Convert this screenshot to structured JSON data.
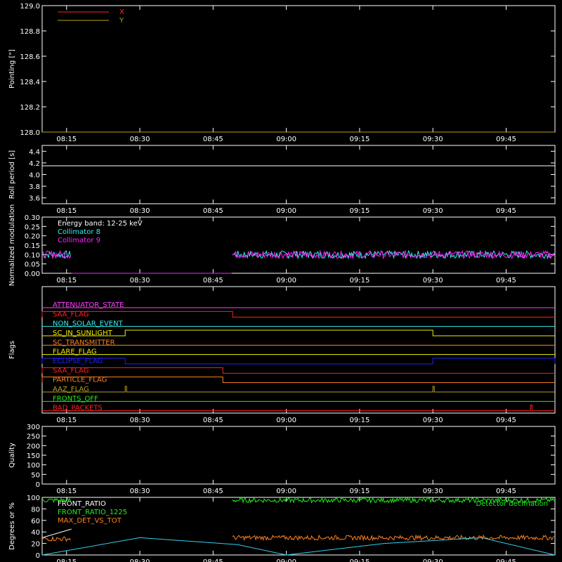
{
  "time_ticks": [
    "08:15",
    "08:30",
    "08:45",
    "09:00",
    "09:15",
    "09:30",
    "09:45"
  ],
  "chart_data": [
    {
      "type": "line",
      "ylabel": "Pointing [\"]",
      "ylim": [
        128.0,
        129.0
      ],
      "yticks": [
        "128.0",
        "128.2",
        "128.4",
        "128.6",
        "128.8",
        "129.0"
      ],
      "series": [
        {
          "name": "X",
          "color": "#ff2020",
          "x": [
            "08:10",
            "09:55"
          ],
          "values": [
            128.0,
            128.0
          ]
        },
        {
          "name": "Y",
          "color": "#b8a020",
          "x": [
            "08:10",
            "09:55"
          ],
          "values": [
            128.0,
            128.0
          ]
        }
      ],
      "legend": "top-left"
    },
    {
      "type": "line",
      "ylabel": "Roll period [s]",
      "ylim": [
        3.5,
        4.5
      ],
      "yticks": [
        "3.6",
        "3.8",
        "4.0",
        "4.2",
        "4.4"
      ],
      "series": [
        {
          "color": "#ffffff",
          "x": [
            "08:10",
            "09:55"
          ],
          "values": [
            4.15,
            4.15
          ]
        }
      ]
    },
    {
      "type": "line",
      "ylabel": "Normalized modulation",
      "ylim": [
        0.0,
        0.3
      ],
      "yticks": [
        "0.00",
        "0.05",
        "0.10",
        "0.15",
        "0.20",
        "0.25",
        "0.30"
      ],
      "annotation": "Energy band: 12-25 keV",
      "series": [
        {
          "name": "Collimator 8",
          "color": "#30f0f0",
          "segments": [
            {
              "x": [
                "08:10",
                "08:16"
              ],
              "level": 0.1
            },
            {
              "x": [
                "08:16",
                "08:49"
              ],
              "level": 0.0
            },
            {
              "x": [
                "08:49",
                "09:55"
              ],
              "level": 0.1
            }
          ]
        },
        {
          "name": "Collimator 9",
          "color": "#ff20ff",
          "segments": [
            {
              "x": [
                "08:10",
                "08:16"
              ],
              "level": 0.1
            },
            {
              "x": [
                "08:16",
                "08:49"
              ],
              "level": 0.0
            },
            {
              "x": [
                "08:49",
                "09:55"
              ],
              "level": 0.1
            }
          ]
        }
      ],
      "legend": "top-left"
    },
    {
      "type": "line",
      "ylabel": "Flags",
      "flags": [
        {
          "name": "ATTENUATOR_STATE",
          "color": "#ff40ff",
          "events": []
        },
        {
          "name": "SAA_FLAG",
          "color": "#ff2020",
          "events": [
            [
              "08:10",
              "08:49"
            ]
          ]
        },
        {
          "name": "NON_SOLAR_EVENT",
          "color": "#30f0f0",
          "events": []
        },
        {
          "name": "SC_IN_SUNLIGHT",
          "color": "#f0f000",
          "events": [
            [
              "08:27",
              "09:30"
            ]
          ]
        },
        {
          "name": "SC_TRANSMITTER",
          "color": "#ff8020",
          "events": []
        },
        {
          "name": "FLARE_FLAG",
          "color": "#f0f000",
          "events": []
        },
        {
          "name": "ECLIPSE_FLAG",
          "color": "#2020ff",
          "events": [
            [
              "08:10",
              "08:27"
            ],
            [
              "09:30",
              "09:55"
            ]
          ]
        },
        {
          "name": "SAA_FLAG",
          "color": "#ff2020",
          "events": [
            [
              "08:10",
              "08:47"
            ]
          ]
        },
        {
          "name": "PARTICLE_FLAG",
          "color": "#ff8020",
          "events": [
            [
              "08:10",
              "08:47"
            ]
          ]
        },
        {
          "name": "AAZ_FLAG",
          "color": "#b8a020",
          "events": [
            [
              "08:27",
              "08:27"
            ],
            [
              "09:30",
              "09:30"
            ]
          ]
        },
        {
          "name": "FRONTS_OFF",
          "color": "#20f020",
          "events": []
        },
        {
          "name": "BAD_PACKETS",
          "color": "#ff2020",
          "events": [
            [
              "09:50",
              "09:50"
            ]
          ]
        }
      ]
    },
    {
      "type": "line",
      "ylabel": "Quality",
      "ylim": [
        0,
        300
      ],
      "yticks": [
        "0",
        "50",
        "100",
        "150",
        "200",
        "250",
        "300"
      ],
      "series": []
    },
    {
      "type": "line",
      "ylabel": "Degrees or %",
      "ylim": [
        0,
        100
      ],
      "yticks": [
        "0",
        "20",
        "40",
        "60",
        "80",
        "100"
      ],
      "annotation": "Detector decimation",
      "series": [
        {
          "name": "FRONT_RATIO",
          "color": "#ffffff",
          "x": [
            "08:10",
            "08:16"
          ],
          "values": [
            30,
            45
          ]
        },
        {
          "name": "FRONT_RATIO_1225",
          "color": "#20f020",
          "segments": [
            {
              "x": [
                "08:10",
                "08:16"
              ],
              "level": 95
            },
            {
              "x": [
                "08:49",
                "09:55"
              ],
              "level": 95
            }
          ]
        },
        {
          "name": "MAX_DET_VS_TOT",
          "color": "#ff8020",
          "segments": [
            {
              "x": [
                "08:10",
                "08:16"
              ],
              "level": 28
            },
            {
              "x": [
                "08:49",
                "09:55"
              ],
              "level": 30
            }
          ]
        },
        {
          "color": "#30d0f0",
          "x": [
            "08:10",
            "08:30",
            "08:50",
            "09:00",
            "09:20",
            "09:40",
            "09:55"
          ],
          "values": [
            0,
            30,
            18,
            0,
            20,
            30,
            0
          ]
        }
      ],
      "legend": "top-left"
    }
  ]
}
